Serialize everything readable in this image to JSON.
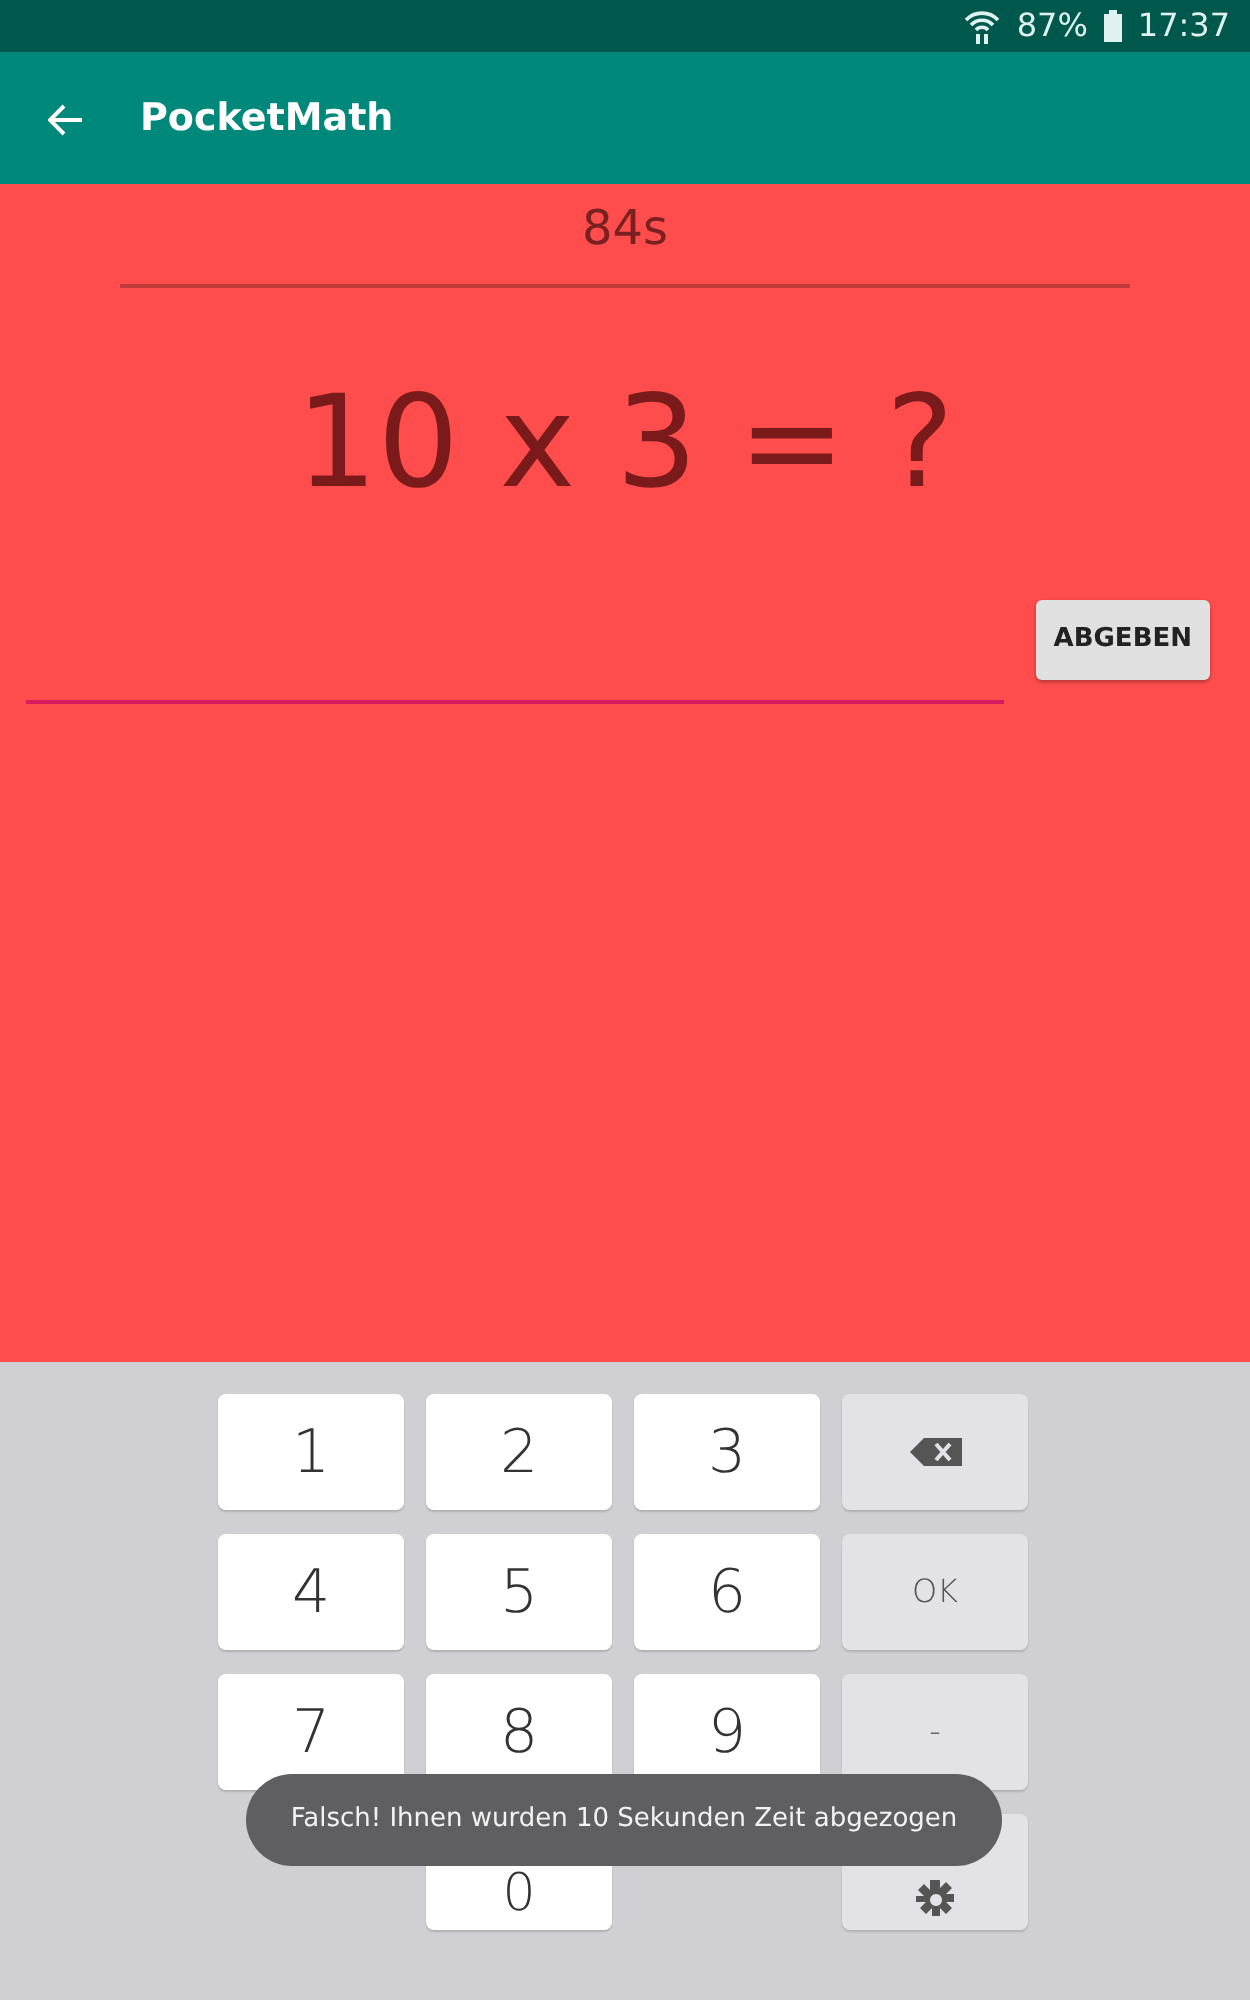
{
  "status_bar": {
    "battery": "87%",
    "time": "17:37"
  },
  "app_bar": {
    "title": "PocketMath"
  },
  "quiz": {
    "timer": "84s",
    "question": "10 x 3 = ?",
    "submit": "ABGEBEN"
  },
  "keyboard": {
    "rows": [
      [
        {
          "kind": "digit",
          "label": "1"
        },
        {
          "kind": "digit",
          "label": "2"
        },
        {
          "kind": "digit",
          "label": "3"
        },
        {
          "kind": "backspace"
        }
      ],
      [
        {
          "kind": "digit",
          "label": "4"
        },
        {
          "kind": "digit",
          "label": "5"
        },
        {
          "kind": "digit",
          "label": "6"
        },
        {
          "kind": "action",
          "label": "OK"
        }
      ],
      [
        {
          "kind": "digit",
          "label": "7"
        },
        {
          "kind": "digit",
          "label": "8"
        },
        {
          "kind": "digit",
          "label": "9"
        },
        {
          "kind": "action",
          "label": "-"
        }
      ],
      [
        {
          "kind": "blank"
        },
        {
          "kind": "digit",
          "label": "0"
        },
        {
          "kind": "blank"
        },
        {
          "kind": "settings"
        }
      ]
    ]
  },
  "toast": {
    "text": "Falsch! Ihnen wurden 10 Sekunden Zeit abgezogen"
  }
}
